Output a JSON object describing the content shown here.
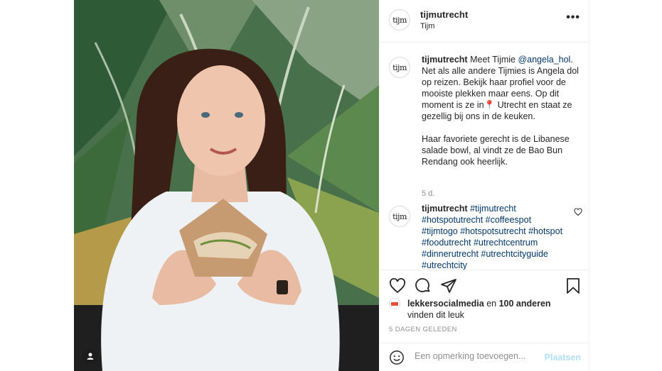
{
  "post": {
    "username": "tijmutrecht",
    "location": "Tijm",
    "avatar_text": "tijm",
    "more_icon": "more-options-icon"
  },
  "caption": {
    "username": "tijmutrecht",
    "text_before_mention": "Meet Tijmie ",
    "mention": "@angela_hol",
    "text_after_mention": ". Net als alle andere Tijmies is Angela dol op reizen. Bekijk haar profiel voor de mooiste plekken maar eens. Op dit moment is ze in📍 Utrecht en staat ze gezellig bij ons in de keuken.\n\nHaar favoriete gerecht is de Libanese salade bowl, al vindt ze de Bao Bun Rendang ook heerlijk.",
    "age": "5 d."
  },
  "comment": {
    "username": "tijmutrecht",
    "hashtags": "#tijmutrecht #hotspotutrecht #coffeespot #tijmtogo #hotspotsutrecht #hotspot #foodutrecht #utrechtcentrum #dinnerutrecht #utrechtcityguide #utrechtcity"
  },
  "likes": {
    "liker": "lekkersocialmedia",
    "and_text": " en ",
    "others": "100 anderen",
    "suffix": "vinden dit leuk"
  },
  "date": "5 DAGEN GELEDEN",
  "add_comment": {
    "placeholder": "Een opmerking toevoegen...",
    "post_label": "Plaatsen"
  },
  "colors": {
    "link": "#00376b",
    "muted": "#8e8e8e",
    "post_disabled": "#b2dffc"
  }
}
